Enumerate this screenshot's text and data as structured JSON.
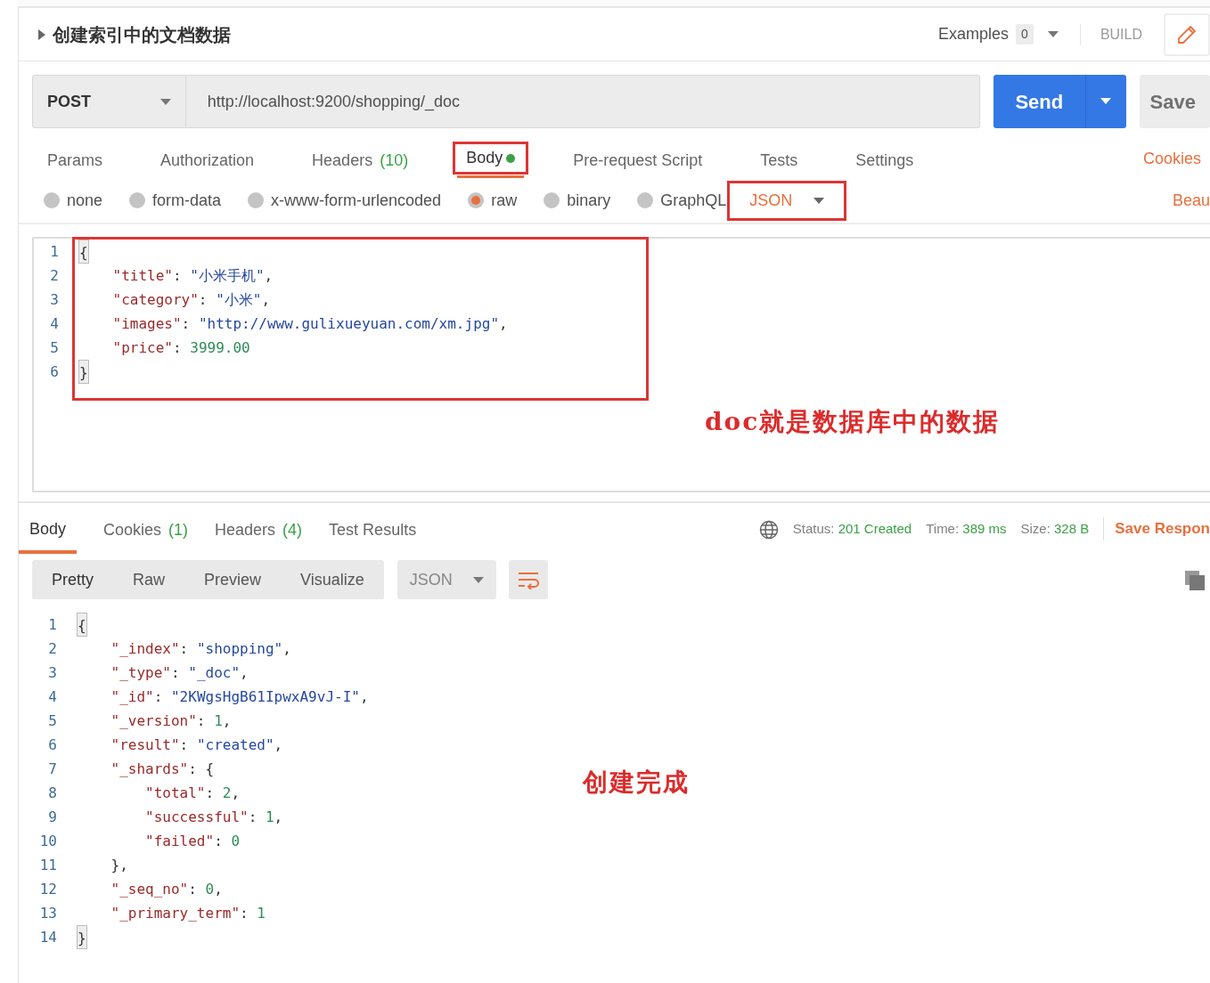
{
  "request": {
    "name": "创建索引中的文档数据",
    "examples_label": "Examples",
    "examples_count": "0",
    "build_label": "BUILD",
    "method": "POST",
    "url": "http://localhost:9200/shopping/_doc",
    "send_label": "Send",
    "save_label": "Save"
  },
  "request_tabs": [
    {
      "label": "Params",
      "selected": false,
      "highlighted": false
    },
    {
      "label": "Authorization",
      "selected": false,
      "highlighted": false
    },
    {
      "label": "Headers",
      "count": "(10)",
      "selected": false,
      "highlighted": false
    },
    {
      "label": "Body",
      "selected": true,
      "has_content": true,
      "highlighted": true
    },
    {
      "label": "Pre-request Script",
      "selected": false,
      "highlighted": false
    },
    {
      "label": "Tests",
      "selected": false,
      "highlighted": false
    },
    {
      "label": "Settings",
      "selected": false,
      "highlighted": false
    }
  ],
  "cookies_link": "Cookies",
  "body_modes": [
    {
      "label": "none",
      "selected": false
    },
    {
      "label": "form-data",
      "selected": false
    },
    {
      "label": "x-www-form-urlencoded",
      "selected": false
    },
    {
      "label": "raw",
      "selected": true
    },
    {
      "label": "binary",
      "selected": false
    },
    {
      "label": "GraphQL",
      "selected": false
    }
  ],
  "format_dropdown": {
    "label": "JSON",
    "highlighted": true
  },
  "beautify_link": "Beau",
  "request_body": {
    "highlighted": true,
    "note": "doc就是数据库中的数据",
    "lines": [
      {
        "number": "1",
        "text": "{",
        "matched_bracket": true
      },
      {
        "number": "2",
        "text": "    \"title\": \"小米手机\","
      },
      {
        "number": "3",
        "text": "    \"category\": \"小米\","
      },
      {
        "number": "4",
        "text": "    \"images\": \"http://www.gulixueyuan.com/xm.jpg\","
      },
      {
        "number": "5",
        "text": "    \"price\": 3999.00"
      },
      {
        "number": "6",
        "text": "}",
        "matched_bracket": true
      }
    ]
  },
  "response_tabs": [
    {
      "label": "Body",
      "selected": true
    },
    {
      "label": "Cookies",
      "count": "(1)",
      "selected": false
    },
    {
      "label": "Headers",
      "count": "(4)",
      "selected": false
    },
    {
      "label": "Test Results",
      "selected": false
    }
  ],
  "response_meta": [
    {
      "label": "Status:",
      "value": "201 Created"
    },
    {
      "label": "Time:",
      "value": "389 ms"
    },
    {
      "label": "Size:",
      "value": "328 B"
    }
  ],
  "save_response_label": "Save Respon",
  "view_modes": [
    {
      "label": "Pretty",
      "selected": true
    },
    {
      "label": "Raw",
      "selected": false
    },
    {
      "label": "Preview",
      "selected": false
    },
    {
      "label": "Visualize",
      "selected": false
    }
  ],
  "response_format": "JSON",
  "response_body": {
    "note": "创建完成",
    "lines": [
      {
        "number": "1",
        "text": "{",
        "matched_bracket": true
      },
      {
        "number": "2",
        "text": "    \"_index\": \"shopping\","
      },
      {
        "number": "3",
        "text": "    \"_type\": \"_doc\","
      },
      {
        "number": "4",
        "text": "    \"_id\": \"2KWgsHgB61IpwxA9vJ-I\","
      },
      {
        "number": "5",
        "text": "    \"_version\": 1,"
      },
      {
        "number": "6",
        "text": "    \"result\": \"created\","
      },
      {
        "number": "7",
        "text": "    \"_shards\": {"
      },
      {
        "number": "8",
        "text": "        \"total\": 2,"
      },
      {
        "number": "9",
        "text": "        \"successful\": 1,"
      },
      {
        "number": "10",
        "text": "        \"failed\": 0"
      },
      {
        "number": "11",
        "text": "    },"
      },
      {
        "number": "12",
        "text": "    \"_seq_no\": 0,"
      },
      {
        "number": "13",
        "text": "    \"_primary_term\": 1"
      },
      {
        "number": "14",
        "text": "}",
        "matched_bracket": true
      }
    ]
  }
}
